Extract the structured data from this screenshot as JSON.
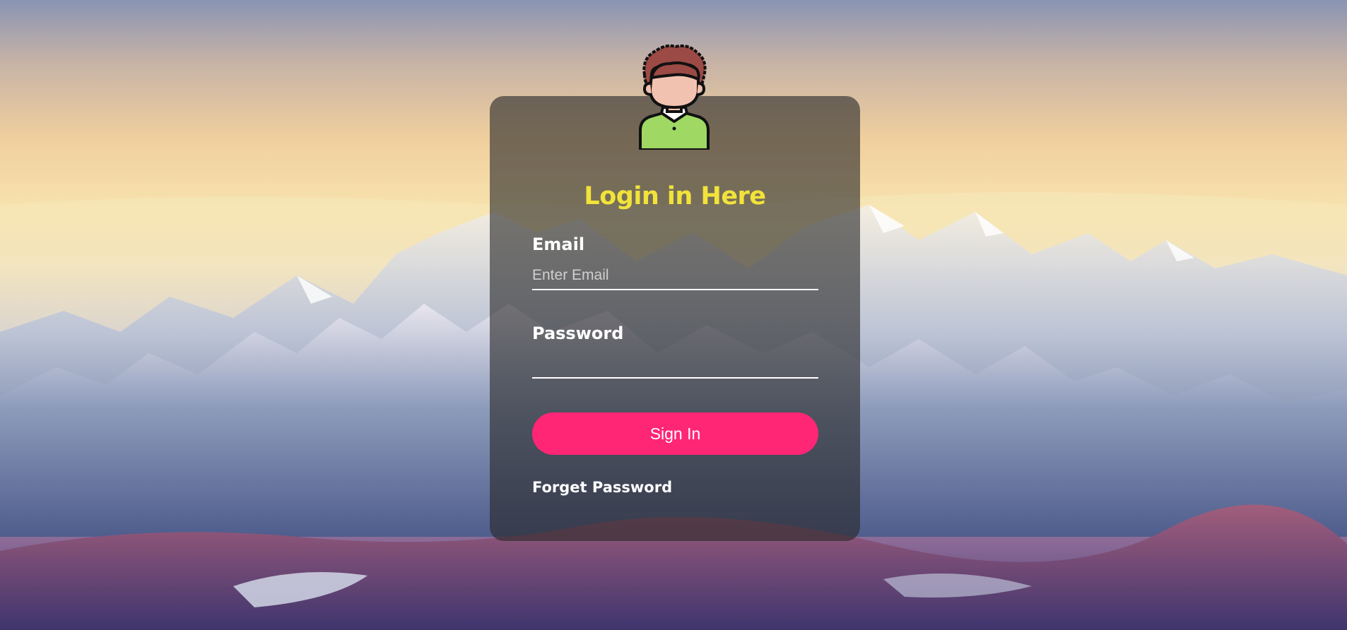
{
  "login": {
    "title": "Login in Here",
    "email_label": "Email",
    "email_placeholder": "Enter Email",
    "email_value": "",
    "password_label": "Password",
    "password_placeholder": "",
    "password_value": "",
    "sign_in_label": "Sign In",
    "forget_password_label": "Forget Password"
  },
  "icons": {
    "avatar": "user-avatar-icon"
  },
  "colors": {
    "title": "#f1e33a",
    "button": "#ff2676",
    "card_background": "rgba(40,40,40,0.62)",
    "text": "#ffffff"
  }
}
